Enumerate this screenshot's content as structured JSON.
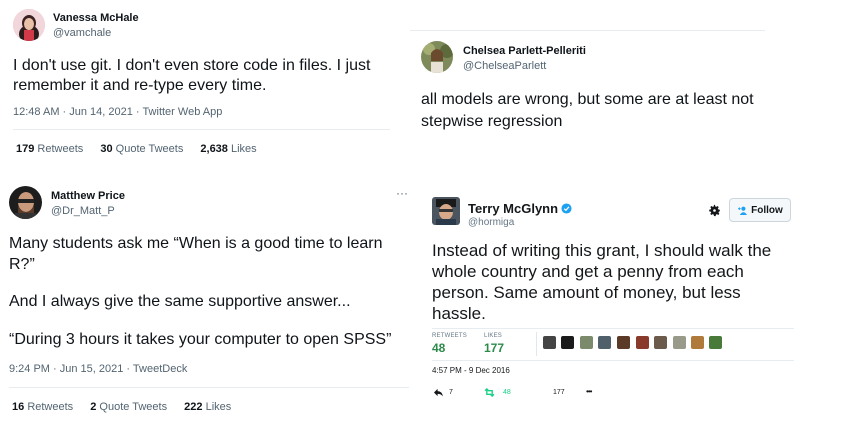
{
  "tweets": {
    "vanessa": {
      "name": "Vanessa McHale",
      "handle": "@vamchale",
      "text_line1": "I don't use git. I don't even store code in files. I just",
      "text_line2": "remember it and re-type every time.",
      "meta": "12:48 AM · Jun 14, 2021 · Twitter Web App",
      "retweets_count": "179",
      "retweets_label": "Retweets",
      "quotes_count": "30",
      "quotes_label": "Quote Tweets",
      "likes_count": "2,638",
      "likes_label": "Likes"
    },
    "chelsea": {
      "name": "Chelsea Parlett-Pelleriti",
      "handle": "@ChelseaParlett",
      "text_line1": "all models are wrong, but some are at least not",
      "text_line2": "stepwise regression"
    },
    "matthew": {
      "name": "Matthew Price",
      "handle": "@Dr_Matt_P",
      "more": "···",
      "line1": "Many students ask me “When is a good time to learn",
      "line2": "R?”",
      "line3": "And I always give the same supportive answer...",
      "line4": "“During 3 hours it takes your computer to open SPSS”",
      "meta": "9:24 PM · Jun 15, 2021 · TweetDeck",
      "retweets_count": "16",
      "retweets_label": "Retweets",
      "quotes_count": "2",
      "quotes_label": "Quote Tweets",
      "likes_count": "222",
      "likes_label": "Likes"
    },
    "terry": {
      "name": "Terry McGlynn",
      "handle": "@hormiga",
      "follow_label": "Follow",
      "line1": "Instead of writing this grant, I should walk the",
      "line2": "whole country and get a penny from each",
      "line3": "person. Same amount of money, but less",
      "line4": "hassle.",
      "retweets_label": "RETWEETS",
      "retweets_count": "48",
      "likes_label": "LIKES",
      "likes_count": "177",
      "meta": "4:57 PM - 9 Dec 2016",
      "reply_count": "7",
      "retweet_count": "48",
      "like_count": "177",
      "more": "•••"
    }
  },
  "colors": {
    "link_blue": "#1d9bf0",
    "retweet_green": "#19cf86",
    "verified_blue": "#1da1f2"
  }
}
